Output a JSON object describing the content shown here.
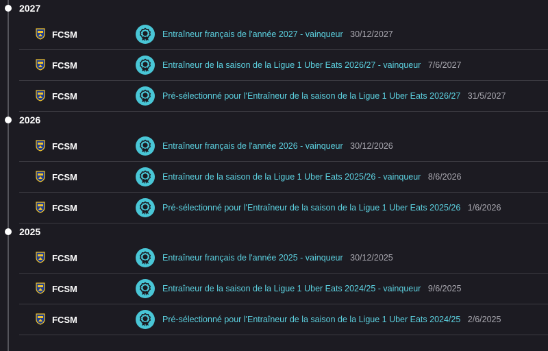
{
  "colors": {
    "background": "#1c1b22",
    "timeline": "#55555c",
    "divider": "#3c3b42",
    "award_icon_bg": "#49c6d6",
    "award_text": "#5cd1e0",
    "date_text": "#a9a8b0",
    "year_text": "#ffffff",
    "club_badge_blue": "#1f3f93",
    "club_badge_yellow": "#f3c42b"
  },
  "icons": {
    "club_badge": "club-crest-icon",
    "award": "rosette-medal-icon",
    "timeline_marker": "timeline-dot-icon"
  },
  "timeline": [
    {
      "year": "2027",
      "entries": [
        {
          "club": "FCSM",
          "award": "Entraîneur français de l'année 2027 - vainqueur",
          "date": "30/12/2027"
        },
        {
          "club": "FCSM",
          "award": "Entraîneur de la saison de la Ligue 1 Uber Eats 2026/27 - vainqueur",
          "date": "7/6/2027"
        },
        {
          "club": "FCSM",
          "award": "Pré-sélectionné pour l'Entraîneur de la saison de la Ligue 1 Uber Eats 2026/27",
          "date": "31/5/2027"
        }
      ]
    },
    {
      "year": "2026",
      "entries": [
        {
          "club": "FCSM",
          "award": "Entraîneur français de l'année 2026 - vainqueur",
          "date": "30/12/2026"
        },
        {
          "club": "FCSM",
          "award": "Entraîneur de la saison de la Ligue 1 Uber Eats 2025/26 - vainqueur",
          "date": "8/6/2026"
        },
        {
          "club": "FCSM",
          "award": "Pré-sélectionné pour l'Entraîneur de la saison de la Ligue 1 Uber Eats 2025/26",
          "date": "1/6/2026"
        }
      ]
    },
    {
      "year": "2025",
      "entries": [
        {
          "club": "FCSM",
          "award": "Entraîneur français de l'année 2025 - vainqueur",
          "date": "30/12/2025"
        },
        {
          "club": "FCSM",
          "award": "Entraîneur de la saison de la Ligue 1 Uber Eats 2024/25 - vainqueur",
          "date": "9/6/2025"
        },
        {
          "club": "FCSM",
          "award": "Pré-sélectionné pour l'Entraîneur de la saison de la Ligue 1 Uber Eats 2024/25",
          "date": "2/6/2025"
        }
      ]
    }
  ]
}
